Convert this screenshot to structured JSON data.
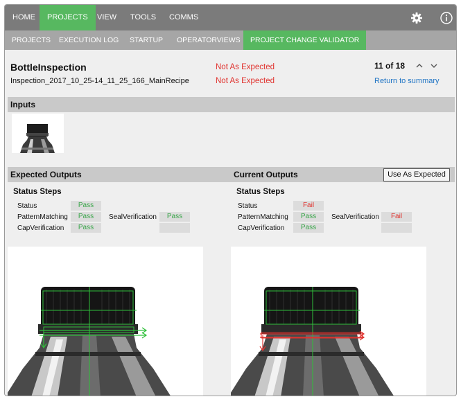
{
  "top_nav": {
    "items": [
      "HOME",
      "PROJECTS",
      "VIEW",
      "TOOLS",
      "COMMS"
    ],
    "active": "PROJECTS"
  },
  "sub_nav": {
    "items": [
      "PROJECTS",
      "EXECUTION LOG",
      "STARTUP",
      "OPERATORVIEWS",
      "PROJECT CHANGE VALIDATOR"
    ],
    "active": "PROJECT CHANGE VALIDATOR"
  },
  "header": {
    "project_name": "BottleInspection",
    "project_status": "Not As Expected",
    "inspection_name": "Inspection_2017_10_25-14_11_25_166_MainRecipe",
    "inspection_status": "Not As Expected",
    "counter": "11 of 18",
    "return_link": "Return to summary"
  },
  "inputs": {
    "title": "Inputs"
  },
  "expected": {
    "title": "Expected Outputs",
    "steps_title": "Status Steps",
    "status_label": "Status",
    "status_value": "Pass",
    "pattern_label": "PatternMatching",
    "pattern_value": "Pass",
    "seal_label": "SealVerification",
    "seal_value": "Pass",
    "cap_label": "CapVerification",
    "cap_value": "Pass"
  },
  "current": {
    "title": "Current Outputs",
    "use_button": "Use As Expected",
    "steps_title": "Status Steps",
    "status_label": "Status",
    "status_value": "Fail",
    "pattern_label": "PatternMatching",
    "pattern_value": "Pass",
    "seal_label": "SealVerification",
    "seal_value": "Fail",
    "cap_label": "CapVerification",
    "cap_value": "Pass"
  },
  "colors": {
    "accent": "#57b860",
    "nav": "#7b7b7b",
    "subnav": "#a6a6a6",
    "fail": "#e0322e",
    "pass": "#3aa64a",
    "link": "#1f74c4"
  },
  "icons": [
    "gear-icon",
    "info-icon",
    "chevron-up-icon",
    "chevron-down-icon"
  ]
}
